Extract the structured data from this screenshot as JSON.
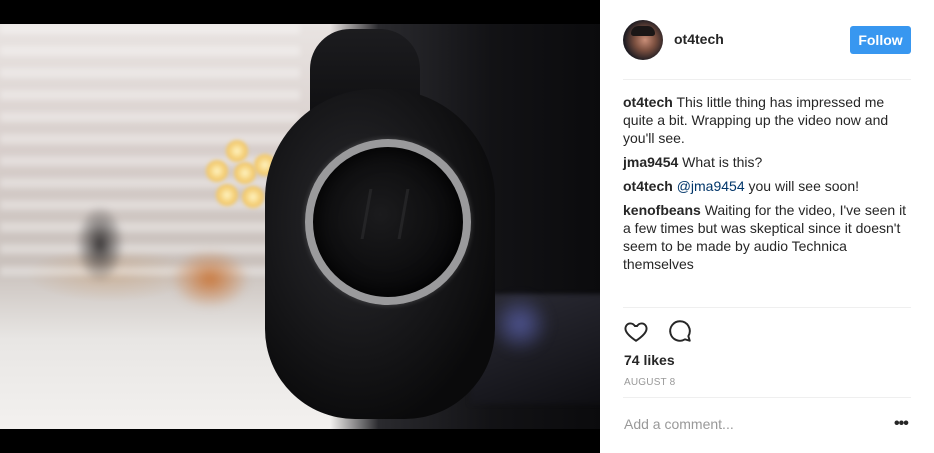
{
  "post": {
    "username": "ot4tech",
    "follow_label": "Follow",
    "likes": "74 likes",
    "date": "AUGUST 8",
    "add_comment_placeholder": "Add a comment...",
    "more_label": "•••"
  },
  "comments": [
    {
      "user": "ot4tech",
      "text": "This little thing has impressed me quite a bit. Wrapping up the video now and you'll see."
    },
    {
      "user": "jma9454",
      "text": "What is this?"
    },
    {
      "user": "ot4tech",
      "mention": "@jma9454",
      "text": "you will see soon!"
    },
    {
      "user": "kenofbeans",
      "text": "Waiting for the video, I've seen it a few times but was skeptical since it doesn't seem to be made by audio Technica themselves"
    }
  ],
  "icons": {
    "like": "heart-icon",
    "comment": "comment-bubble-icon",
    "more": "more-options-icon"
  },
  "colors": {
    "follow_button": "#3897f0",
    "text": "#262626",
    "muted": "#999999",
    "mention": "#003569"
  }
}
